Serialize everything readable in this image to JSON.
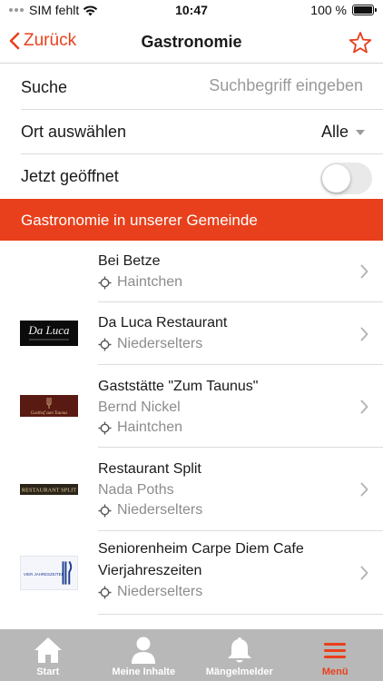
{
  "status_bar": {
    "carrier": "SIM fehlt",
    "time": "10:47",
    "battery": "100 %",
    "battery_level": 1.0
  },
  "nav": {
    "back_label": "Zurück",
    "title": "Gastronomie",
    "favorite_icon": "star-outline-icon"
  },
  "filters": {
    "search_label": "Suche",
    "search_placeholder": "Suchbegriff eingeben",
    "search_value": "",
    "location_label": "Ort auswählen",
    "location_value": "Alle",
    "open_now_label": "Jetzt geöffnet",
    "open_now_on": false
  },
  "section_header": "Gastronomie in unserer Gemeinde",
  "items": [
    {
      "name": "Bei Betze",
      "owner": "",
      "location": "Haintchen",
      "logo": ""
    },
    {
      "name": "Da Luca Restaurant",
      "owner": "",
      "location": "Niederselters",
      "logo": "Da Luca"
    },
    {
      "name": "Gaststätte \"Zum Taunus\"",
      "owner": "Bernd Nickel",
      "location": "Haintchen",
      "logo": "Gasthof zum Taunus"
    },
    {
      "name": "Restaurant Split",
      "owner": "Nada Poths",
      "location": "Niederselters",
      "logo": "RESTAURANT SPLIT"
    },
    {
      "name": "Seniorenheim Carpe Diem Cafe Vierjahreszeiten",
      "name_line1": "Seniorenheim Carpe Diem Cafe",
      "name_line2": "Vierjahreszeiten",
      "owner": "",
      "location": "Niederselters",
      "logo": "VIER JAHRESZEITEN"
    }
  ],
  "tabs": [
    {
      "label": "Start",
      "icon": "home-icon",
      "active": false
    },
    {
      "label": "Meine Inhalte",
      "icon": "person-icon",
      "active": false
    },
    {
      "label": "Mängelmelder",
      "icon": "bell-icon",
      "active": false
    },
    {
      "label": "Menü",
      "icon": "menu-icon",
      "active": true
    }
  ],
  "colors": {
    "accent": "#e8401c",
    "tab_bar": "#b8b8b8"
  }
}
